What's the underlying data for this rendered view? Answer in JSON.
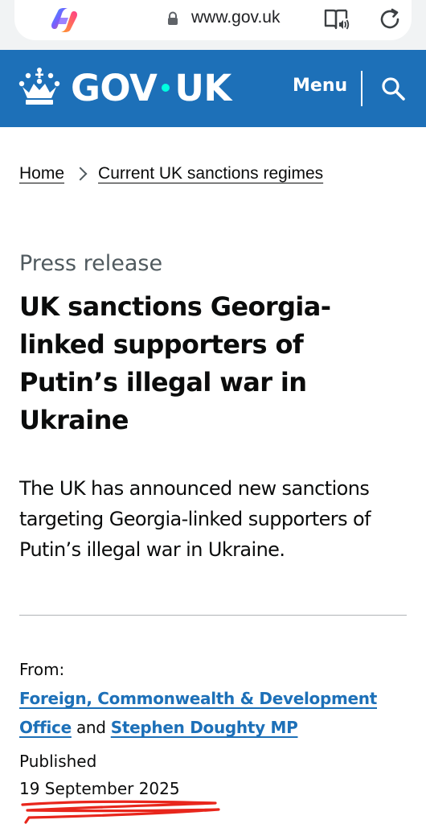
{
  "browser": {
    "url": "www.gov.uk"
  },
  "header": {
    "logo_left": "GOV",
    "logo_right": "UK",
    "menu_label": "Menu"
  },
  "breadcrumbs": [
    {
      "label": "Home"
    },
    {
      "label": "Current UK sanctions regimes"
    }
  ],
  "article": {
    "caption": "Press release",
    "title": "UK sanctions Georgia-linked supporters of Putin’s illegal war in Ukraine",
    "lead": "The UK has announced new sanctions targeting Georgia-linked supporters of Putin’s illegal war in Ukraine.",
    "from_label": "From:",
    "org_1": "Foreign, Commonwealth & Development Office",
    "org_connector": "and",
    "org_2": "Stephen Doughty MP",
    "published_label": "Published",
    "published_date": "19 September 2025"
  },
  "colors": {
    "brand_blue": "#1d70b8",
    "logo_dot": "#00ffe0",
    "text": "#0b0c0c",
    "secondary_text": "#505a5f",
    "annotation_red": "#e8261c"
  },
  "icons": {
    "browser_logo": "copilot-logo-icon",
    "lock": "lock-icon",
    "reader": "reader-mode-icon",
    "reload": "reload-icon",
    "crown": "crown-icon",
    "search": "search-icon"
  }
}
